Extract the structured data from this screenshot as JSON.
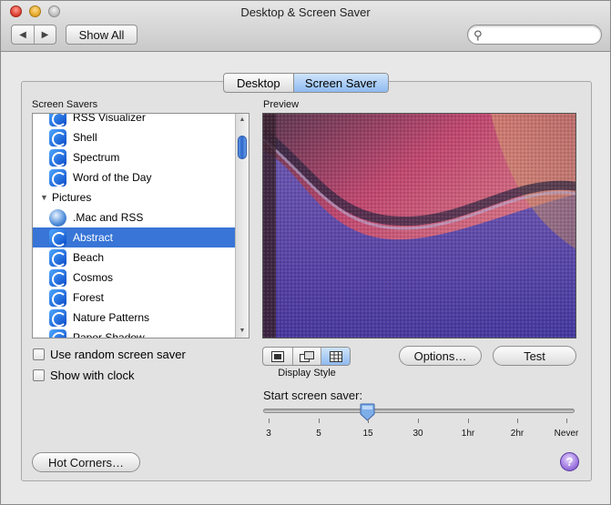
{
  "window": {
    "title": "Desktop & Screen Saver"
  },
  "toolbar": {
    "back_icon": "chevron-left-icon",
    "forward_icon": "chevron-right-icon",
    "show_all_label": "Show All",
    "search_value": ""
  },
  "tabs": [
    {
      "label": "Desktop",
      "selected": false
    },
    {
      "label": "Screen Saver",
      "selected": true
    }
  ],
  "screen_savers": {
    "heading": "Screen Savers",
    "items": [
      {
        "label": "RSS Visualizer",
        "kind": "module",
        "icon": "screensaver-icon"
      },
      {
        "label": "Shell",
        "kind": "module",
        "icon": "screensaver-icon"
      },
      {
        "label": "Spectrum",
        "kind": "module",
        "icon": "screensaver-icon"
      },
      {
        "label": "Word of the Day",
        "kind": "module",
        "icon": "screensaver-icon"
      },
      {
        "label": "Pictures",
        "kind": "group",
        "icon": "disclosure-triangle-icon"
      },
      {
        "label": ".Mac and RSS",
        "kind": "module",
        "icon": "mac-globe-icon"
      },
      {
        "label": "Abstract",
        "kind": "module",
        "icon": "screensaver-icon",
        "selected": true
      },
      {
        "label": "Beach",
        "kind": "module",
        "icon": "screensaver-icon"
      },
      {
        "label": "Cosmos",
        "kind": "module",
        "icon": "screensaver-icon"
      },
      {
        "label": "Forest",
        "kind": "module",
        "icon": "screensaver-icon"
      },
      {
        "label": "Nature Patterns",
        "kind": "module",
        "icon": "screensaver-icon"
      },
      {
        "label": "Paper Shadow",
        "kind": "module",
        "icon": "screensaver-icon"
      }
    ]
  },
  "preview": {
    "heading": "Preview"
  },
  "options": {
    "random_label": "Use random screen saver",
    "random_checked": false,
    "clock_label": "Show with clock",
    "clock_checked": false
  },
  "display_style": {
    "label": "Display Style",
    "options": [
      {
        "icon": "centered-image-icon",
        "selected": false
      },
      {
        "icon": "slideshow-icon",
        "selected": false
      },
      {
        "icon": "mosaic-grid-icon",
        "selected": true
      }
    ]
  },
  "buttons": {
    "options_label": "Options…",
    "test_label": "Test",
    "hot_corners_label": "Hot Corners…",
    "help_label": "?"
  },
  "start_screen_saver": {
    "label": "Start screen saver:",
    "ticks": [
      "3",
      "5",
      "15",
      "30",
      "1hr",
      "2hr",
      "Never"
    ],
    "selected": "15"
  }
}
